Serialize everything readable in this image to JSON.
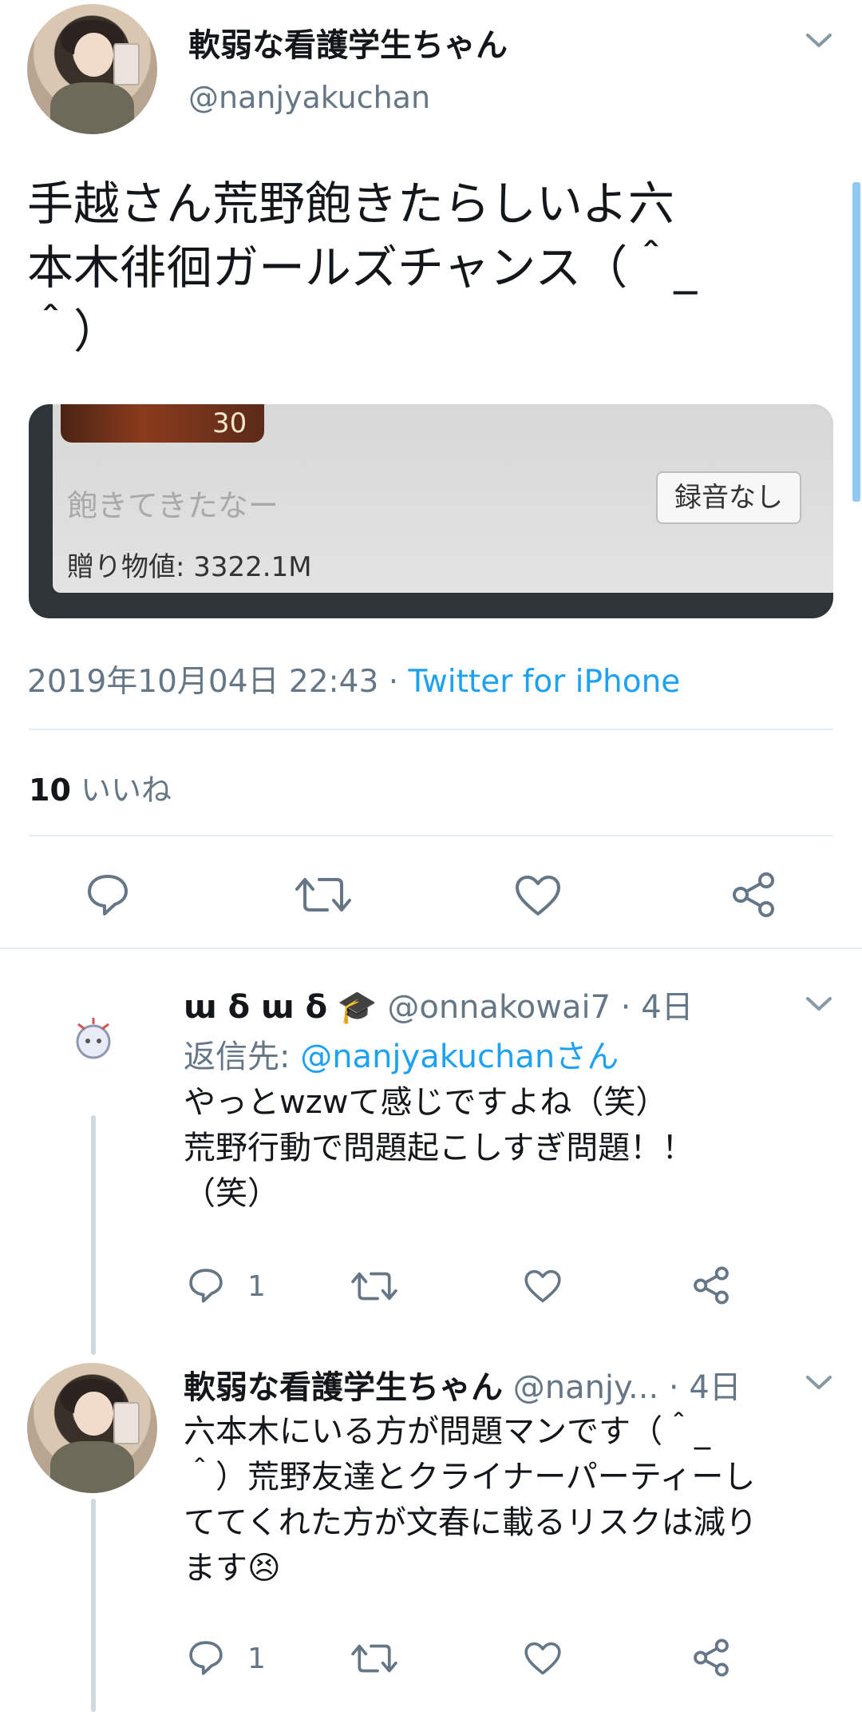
{
  "main_tweet": {
    "display_name": "軟弱な看護学生ちゃん",
    "handle": "@nanjyakuchan",
    "text_lines": [
      "手越さん荒野飽きたらしいよ六",
      "本木徘徊ガールズチャンス（＾_",
      "＾）"
    ],
    "media": {
      "level_badge": "30",
      "message": "飽きてきたなー",
      "button": "録音なし",
      "gift_value": "贈り物値: 3322.1M"
    },
    "timestamp": "2019年10月04日 22:43",
    "separator": "·",
    "source": "Twitter for iPhone",
    "likes_count": "10",
    "likes_label": "いいね"
  },
  "replies": [
    {
      "display_name": "ɯ δ ɯ δ",
      "emoji": "🎓",
      "handle": "@onnakowai7",
      "time": "· 4日",
      "reply_to_label": "返信先: ",
      "reply_to_handle": "@nanjyakuchanさん",
      "text_lines": [
        "やっとwzwて感じですよね（笑）",
        "荒野行動で問題起こしすぎ問題！！",
        "（笑）"
      ],
      "reply_count": "1"
    },
    {
      "display_name": "軟弱な看護学生ちゃん",
      "handle": "@nanjy...",
      "time": "· 4日",
      "text_lines": [
        "六本木にいる方が問題マンです（＾_",
        "＾）荒野友達とクライナーパーティーし",
        "ててくれた方が文春に載るリスクは減り",
        "ます"
      ],
      "emoji_end": "😣",
      "reply_count": "1"
    }
  ],
  "colors": {
    "link": "#1da1f2",
    "muted": "#657786",
    "divider": "#e6ecf0",
    "action_icon": "#657786"
  }
}
